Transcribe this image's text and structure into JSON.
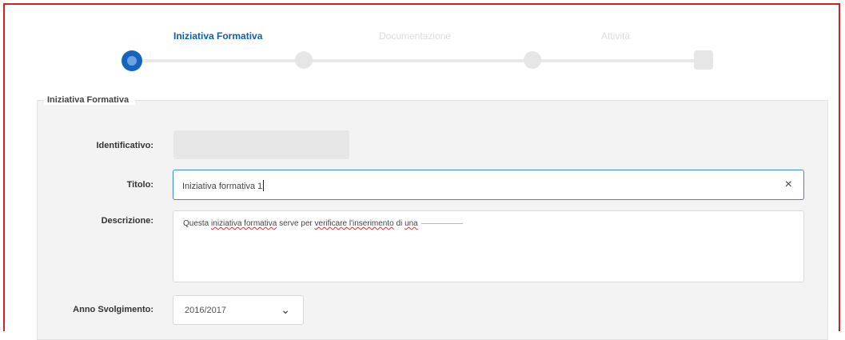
{
  "stepper": {
    "steps": [
      {
        "label": "Iniziativa Formativa",
        "state": "active"
      },
      {
        "label": "Documentazione",
        "state": "inactive"
      },
      {
        "label": "Attività",
        "state": "inactive"
      }
    ],
    "active_color": "#1565c0",
    "inactive_color": "#e6e6e6"
  },
  "section": {
    "legend": "Iniziativa Formativa"
  },
  "form": {
    "identificativo": {
      "label": "Identificativo:",
      "value": ""
    },
    "titolo": {
      "label": "Titolo:",
      "value": "Iniziativa formativa 1"
    },
    "descrizione": {
      "label": "Descrizione:",
      "parts": [
        "Questa ",
        "iniziativa formativa",
        " serve per ",
        "verificare l'inserimento",
        " di ",
        "una",
        ""
      ]
    },
    "anno": {
      "label": "Anno Svolgimento:",
      "value": "2016/2017"
    }
  },
  "icons": {
    "clear": "×",
    "chevron": "⌄"
  },
  "colors": {
    "frame_border": "#d81e1e",
    "focus_border": "#3b8ad9",
    "active_label": "#0b5fb5"
  }
}
